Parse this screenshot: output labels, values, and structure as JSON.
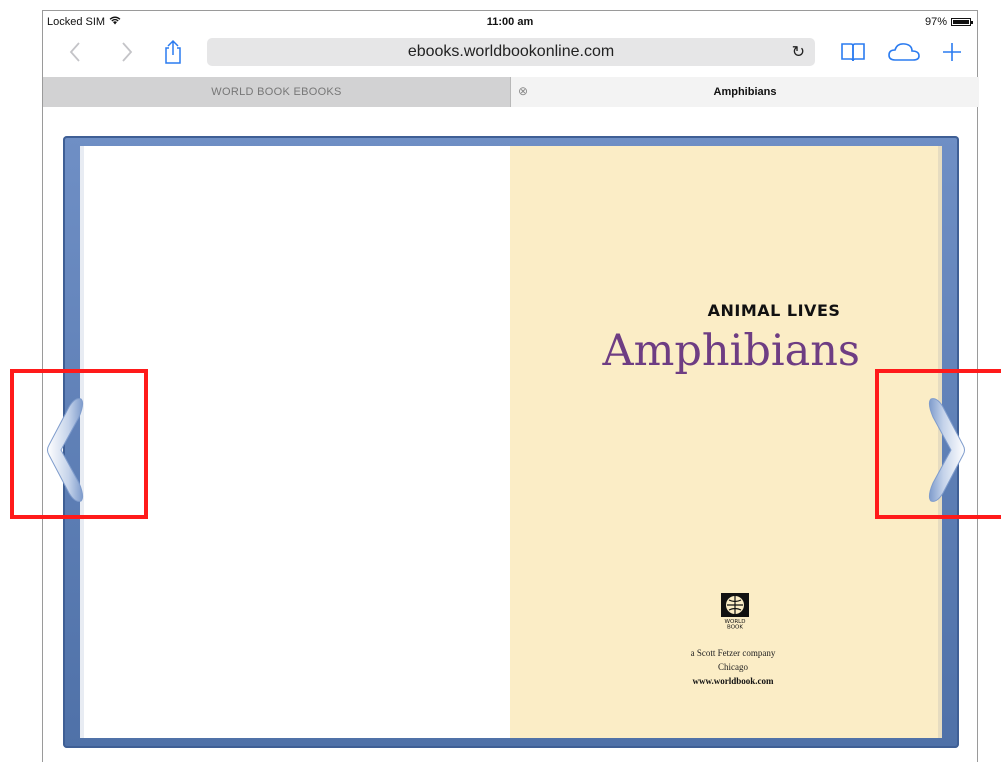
{
  "status_bar": {
    "carrier": "Locked SIM",
    "time": "11:00 am",
    "battery_percent": "97%",
    "battery_level": 0.97
  },
  "toolbar": {
    "url": "ebooks.worldbookonline.com",
    "icons": [
      "back-icon",
      "forward-icon",
      "share-icon",
      "reload-icon",
      "bookmarks-icon",
      "icloud-tabs-icon",
      "new-tab-icon"
    ]
  },
  "tabs": [
    {
      "label": "WORLD BOOK EBOOKS",
      "active": false
    },
    {
      "label": "Amphibians",
      "active": true
    }
  ],
  "book": {
    "series": "ANIMAL LIVES",
    "title": "Amphibians",
    "logo_text": "WORLD BOOK",
    "publisher_line1": "a Scott Fetzer company",
    "publisher_line2": "Chicago",
    "publisher_url": "www.worldbook.com"
  },
  "colors": {
    "accent": "#2a7bf0",
    "book_frame": "#5b7db5",
    "right_page": "#fbedc6",
    "title_color": "#6e3d83",
    "highlight": "#ff1a1a"
  }
}
